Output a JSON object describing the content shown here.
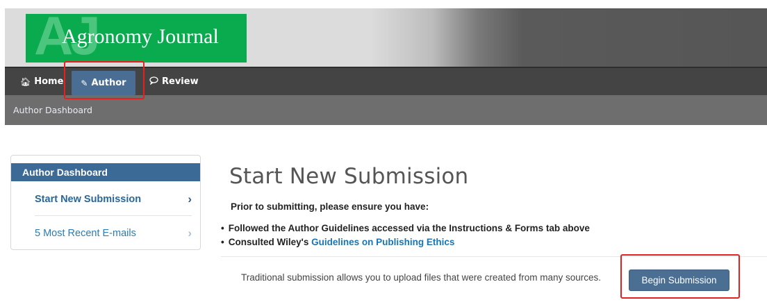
{
  "logo": {
    "watermark": "AJ",
    "title": "Agronomy Journal"
  },
  "nav": {
    "home": {
      "icon": "home-icon",
      "label": "Home"
    },
    "author": {
      "icon": "pencil-icon",
      "label": "Author"
    },
    "review": {
      "icon": "speech-bubble-icon",
      "label": "Review"
    }
  },
  "breadcrumb": "Author Dashboard",
  "sidebar": {
    "header": "Author Dashboard",
    "items": [
      {
        "label": "Start New Submission",
        "icon": "chevron-right-icon"
      },
      {
        "label": "5 Most Recent E-mails",
        "icon": "chevron-right-icon"
      }
    ]
  },
  "main": {
    "title": "Start New Submission",
    "prior": "Prior to submitting, please ensure you have:",
    "bullets": {
      "b1": "Followed the Author Guidelines accessed via the Instructions & Forms tab above",
      "b2_prefix": "Consulted Wiley's ",
      "b2_link": "Guidelines on Publishing Ethics"
    },
    "traditional_text": "Traditional submission allows you to upload files that were created from many sources.",
    "begin_button": "Begin Submission"
  },
  "colors": {
    "logo_green": "#0aaa4e",
    "nav_bg": "#444444",
    "active_tab": "#4a6e93",
    "sidebar_header": "#3c6a96",
    "link": "#1a75b4",
    "highlight": "#e5201e"
  }
}
